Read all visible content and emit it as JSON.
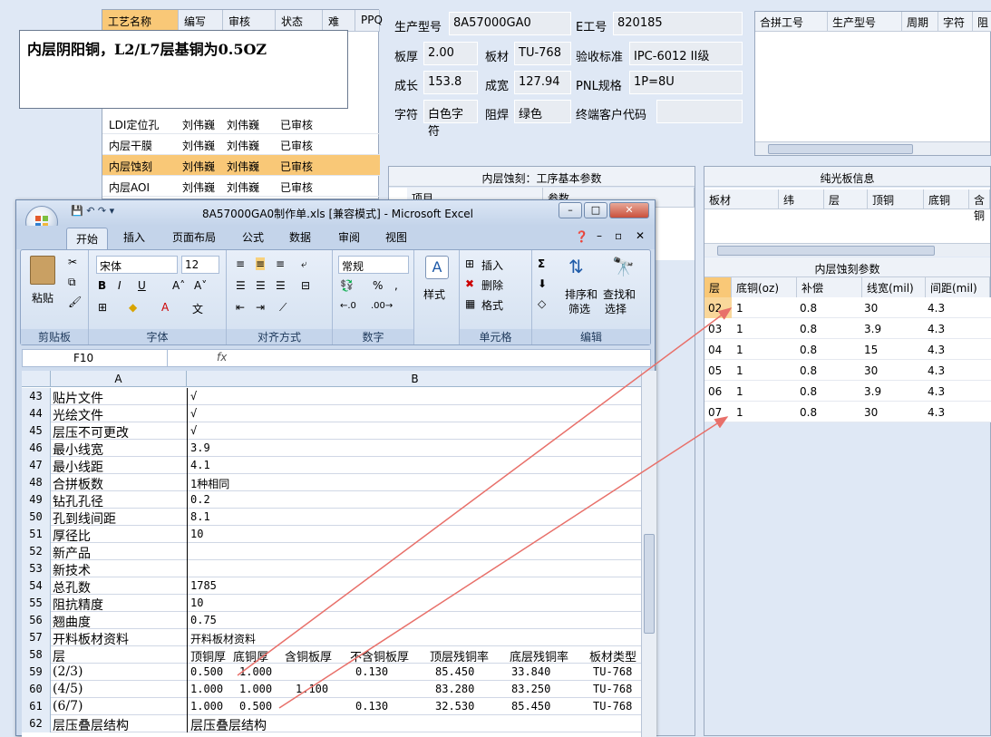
{
  "process_grid": {
    "headers": [
      "工艺名称",
      "编写",
      "审核",
      "状态",
      "难",
      "PPQ"
    ],
    "rows": [
      {
        "name": "LDI定位孔",
        "writer": "刘伟巍",
        "reviewer": "刘伟巍",
        "status": "已审核",
        "selected": false
      },
      {
        "name": "内层干膜",
        "writer": "刘伟巍",
        "reviewer": "刘伟巍",
        "status": "已审核",
        "selected": false
      },
      {
        "name": "内层蚀刻",
        "writer": "刘伟巍",
        "reviewer": "刘伟巍",
        "status": "已审核",
        "selected": true
      },
      {
        "name": "内层AOI",
        "writer": "刘伟巍",
        "reviewer": "刘伟巍",
        "status": "已审核",
        "selected": false
      }
    ]
  },
  "note": {
    "text": "内层阴阳铜，L2/L7层基铜为0.5OZ"
  },
  "info": {
    "model_label": "生产型号",
    "model_value": "8A57000GA0",
    "eno_label": "E工号",
    "eno_value": "820185",
    "thickness_label": "板厚",
    "thickness_value": "2.00",
    "material_label": "板材",
    "material_value": "TU-768",
    "standard_label": "验收标准",
    "standard_value": "IPC-6012 II级",
    "length_label": "成长",
    "length_value": "153.8",
    "width_label": "成宽",
    "width_value": "127.94",
    "pnl_label": "PNL规格",
    "pnl_value": "1P=8U",
    "char_label": "字符",
    "char_value": "白色字符",
    "mask_label": "阻焊",
    "mask_value": "绿色",
    "customer_label": "终端客户代码",
    "customer_value": ""
  },
  "right_grid": {
    "headers": [
      "合拼工号",
      "生产型号",
      "周期",
      "字符",
      "阻"
    ]
  },
  "mid_panel": {
    "title": "内层蚀刻：工序基本参数",
    "col1": "项目",
    "col2": "参数"
  },
  "right_panel": {
    "title": "纯光板信息",
    "headers": [
      "板材",
      "纬",
      "层",
      "顶铜",
      "底铜",
      "含铜"
    ],
    "etch_title": "内层蚀刻参数",
    "etch_headers": [
      "层",
      "底铜(oz)",
      "补偿",
      "线宽(mil)",
      "间距(mil)"
    ],
    "etch_rows": [
      {
        "layer": "02",
        "copper": "1",
        "comp": "0.8",
        "width": "30",
        "space": "4.3"
      },
      {
        "layer": "03",
        "copper": "1",
        "comp": "0.8",
        "width": "3.9",
        "space": "4.3"
      },
      {
        "layer": "04",
        "copper": "1",
        "comp": "0.8",
        "width": "15",
        "space": "4.3"
      },
      {
        "layer": "05",
        "copper": "1",
        "comp": "0.8",
        "width": "30",
        "space": "4.3"
      },
      {
        "layer": "06",
        "copper": "1",
        "comp": "0.8",
        "width": "3.9",
        "space": "4.3"
      },
      {
        "layer": "07",
        "copper": "1",
        "comp": "0.8",
        "width": "30",
        "space": "4.3"
      }
    ]
  },
  "excel": {
    "title": "8A57000GA0制作单.xls  [兼容模式] - Microsoft Excel",
    "tabs": [
      "开始",
      "插入",
      "页面布局",
      "公式",
      "数据",
      "审阅",
      "视图"
    ],
    "clipboard": {
      "paste": "粘贴",
      "group": "剪贴板"
    },
    "font": {
      "name": "宋体",
      "size": "12",
      "group": "字体"
    },
    "align": {
      "group": "对齐方式"
    },
    "number": {
      "format": "常规",
      "group": "数字"
    },
    "styles": {
      "label": "样式"
    },
    "cells": {
      "insert": "插入",
      "delete": "删除",
      "format": "格式",
      "group": "单元格"
    },
    "edit": {
      "sort": "排序和",
      "sort2": "筛选",
      "find": "查找和",
      "find2": "选择",
      "group": "编辑"
    },
    "namebox": "F10",
    "fx": "fx",
    "col_a": "A",
    "col_b": "B",
    "rows": [
      {
        "n": "43",
        "a": "贴片文件",
        "b": "√"
      },
      {
        "n": "44",
        "a": "光绘文件",
        "b": "√"
      },
      {
        "n": "45",
        "a": "层压不可更改",
        "b": "√"
      },
      {
        "n": "46",
        "a": "最小线宽",
        "b": "3.9"
      },
      {
        "n": "47",
        "a": "最小线距",
        "b": "4.1"
      },
      {
        "n": "48",
        "a": "合拼板数",
        "b": "1种相同"
      },
      {
        "n": "49",
        "a": "钻孔孔径",
        "b": "0.2"
      },
      {
        "n": "50",
        "a": "孔到线间距",
        "b": "8.1"
      },
      {
        "n": "51",
        "a": "厚径比",
        "b": "10"
      },
      {
        "n": "52",
        "a": "新产品",
        "b": ""
      },
      {
        "n": "53",
        "a": "新技术",
        "b": ""
      },
      {
        "n": "54",
        "a": "总孔数",
        "b": "1785"
      },
      {
        "n": "55",
        "a": "阻抗精度",
        "b": "10"
      },
      {
        "n": "56",
        "a": "翘曲度",
        "b": "0.75"
      },
      {
        "n": "57",
        "a": "开料板材资料",
        "b": "开料板材资料"
      }
    ],
    "row58": {
      "n": "58",
      "a": "层",
      "c1": "顶铜厚",
      "c2": "底铜厚",
      "c3": "含铜板厚",
      "c4": "不含铜板厚",
      "c5": "顶层残铜率",
      "c6": "底层残铜率",
      "c7": "板材类型"
    },
    "layer_rows": [
      {
        "n": "59",
        "a": "(2/3)",
        "top": "0.500",
        "bot": "1.000",
        "with": "",
        "without": "0.130",
        "topres": "85.450",
        "botres": "33.840",
        "mat": "TU-768"
      },
      {
        "n": "60",
        "a": "(4/5)",
        "top": "1.000",
        "bot": "1.000",
        "with": "1.100",
        "without": "",
        "topres": "83.280",
        "botres": "83.250",
        "mat": "TU-768"
      },
      {
        "n": "61",
        "a": "(6/7)",
        "top": "1.000",
        "bot": "0.500",
        "with": "",
        "without": "0.130",
        "topres": "32.530",
        "botres": "85.450",
        "mat": "TU-768"
      }
    ],
    "row62": {
      "n": "62",
      "a": "层压叠层结构",
      "b": "层压叠层结构"
    }
  },
  "colors": {
    "selected": "#f9c877",
    "arrow": "#e8706a",
    "accent": "#1e395b"
  }
}
